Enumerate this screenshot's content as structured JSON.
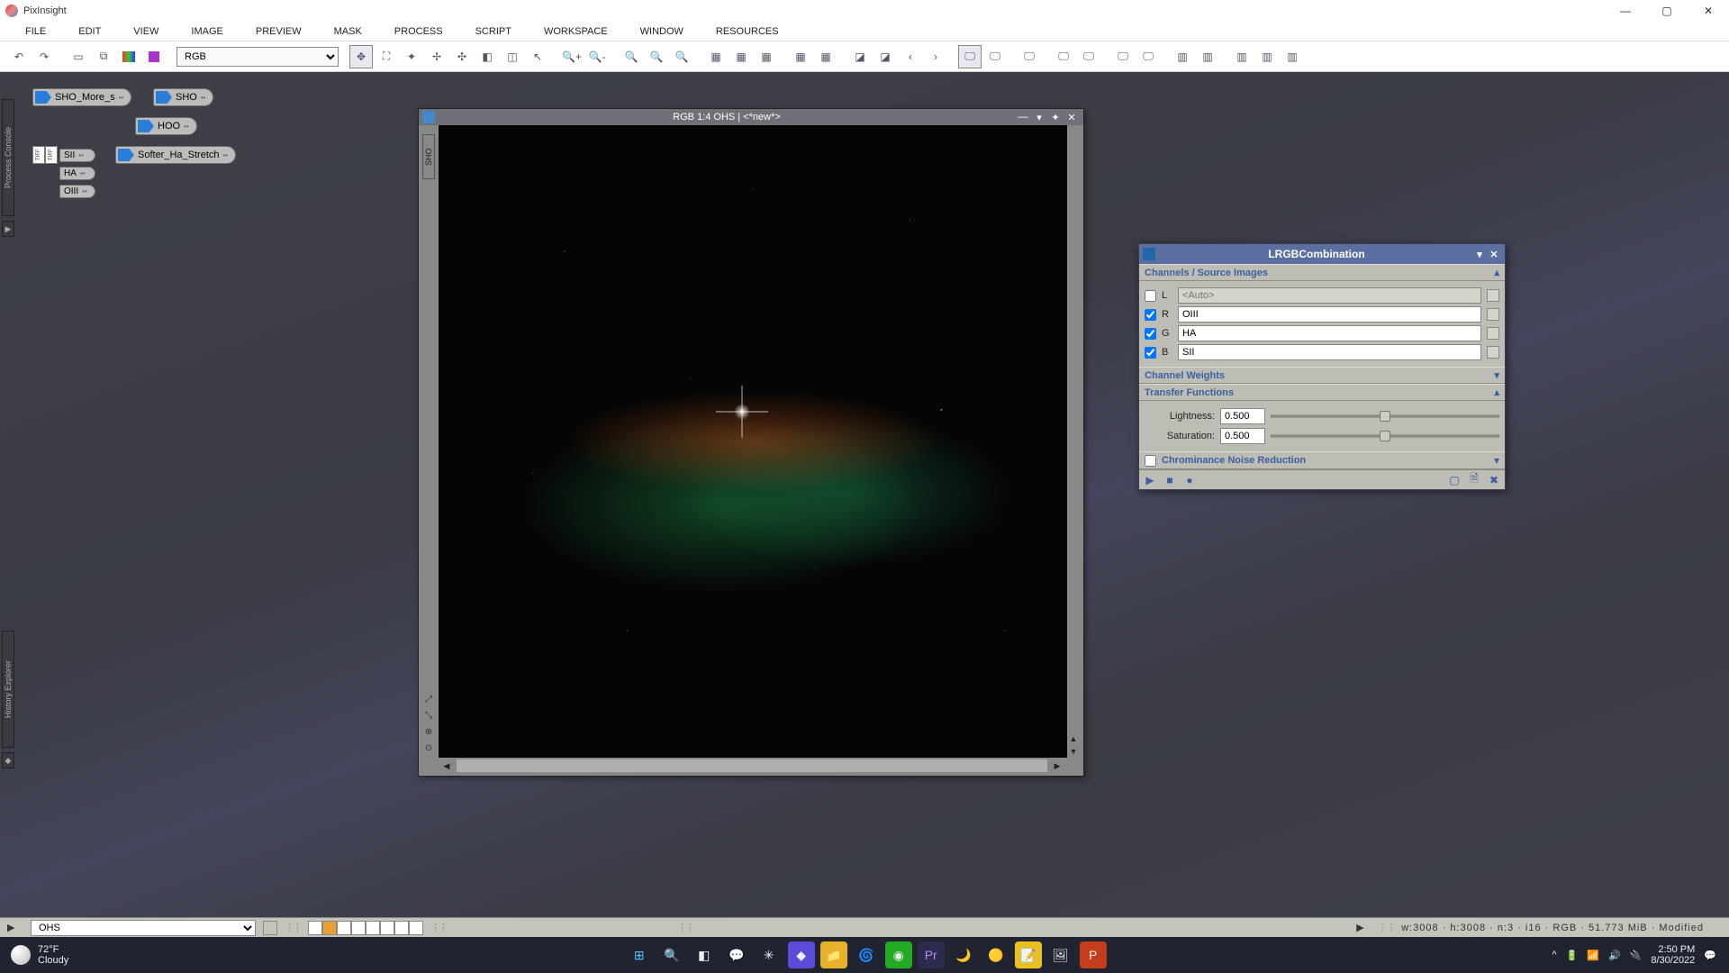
{
  "app": {
    "title": "PixInsight"
  },
  "menu": [
    "FILE",
    "EDIT",
    "VIEW",
    "IMAGE",
    "PREVIEW",
    "MASK",
    "PROCESS",
    "SCRIPT",
    "WORKSPACE",
    "WINDOW",
    "RESOURCES"
  ],
  "toolbar": {
    "colorspace": "RGB"
  },
  "sidebar": {
    "process_console": "Process Console",
    "history_explorer": "History Explorer"
  },
  "nodes": {
    "n1": "SHO_More_s",
    "n2": "SHO",
    "n3": "HOO",
    "n4": "Softer_Ha_Stretch",
    "mini": [
      "SII",
      "HA",
      "OIII"
    ]
  },
  "image_window": {
    "title": "RGB 1:4 OHS | <*new*>",
    "side_tab": "SHO"
  },
  "dialog": {
    "title": "LRGBCombination",
    "section_channels": "Channels / Source Images",
    "channels": {
      "L": {
        "checked": false,
        "value": "",
        "placeholder": "<Auto>"
      },
      "R": {
        "checked": true,
        "value": "OIII"
      },
      "G": {
        "checked": true,
        "value": "HA"
      },
      "B": {
        "checked": true,
        "value": "SII"
      }
    },
    "section_weights": "Channel Weights",
    "section_transfer": "Transfer Functions",
    "lightness_label": "Lightness:",
    "lightness_value": "0.500",
    "saturation_label": "Saturation:",
    "saturation_value": "0.500",
    "cnr_label": "Chrominance Noise Reduction"
  },
  "status": {
    "view": "OHS",
    "info": "w:3008 · h:3008 · n:3 · i16 · RGB · 51.773 MiB · Modified"
  },
  "taskbar": {
    "temp": "72°F",
    "cond": "Cloudy",
    "time": "2:50 PM",
    "date": "8/30/2022"
  }
}
